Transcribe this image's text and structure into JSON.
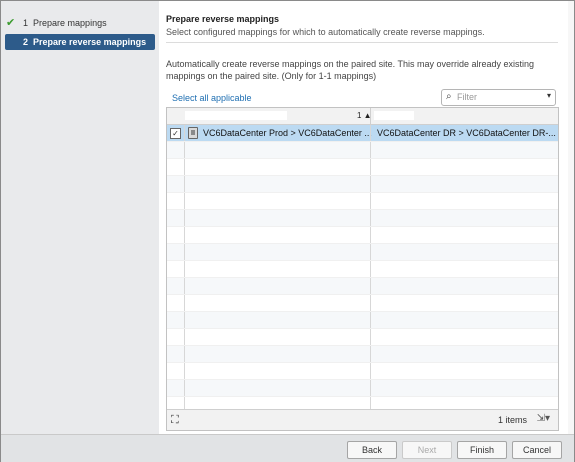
{
  "wizard": {
    "steps": [
      {
        "number": "1",
        "label": "Prepare mappings"
      },
      {
        "number": "2",
        "label": "Prepare reverse mappings"
      }
    ]
  },
  "header": {
    "title": "Prepare reverse mappings",
    "subtitle": "Select configured mappings for which to automatically create reverse mappings."
  },
  "description": "Automatically create reverse mappings on the paired site. This may override already existing mappings on the paired site. (Only for 1-1 mappings)",
  "select_all_label": "Select all applicable",
  "filter": {
    "placeholder": "Filter",
    "icon": "search-icon"
  },
  "table": {
    "sort_indicator": "1 ▲",
    "rows": [
      {
        "checked": true,
        "source": "VC6DataCenter Prod > VC6DataCenter ...",
        "target": "VC6DataCenter DR > VC6DataCenter DR-..."
      }
    ],
    "footer_count": "1 items"
  },
  "buttons": {
    "back": "Back",
    "next": "Next",
    "finish": "Finish",
    "cancel": "Cancel"
  }
}
